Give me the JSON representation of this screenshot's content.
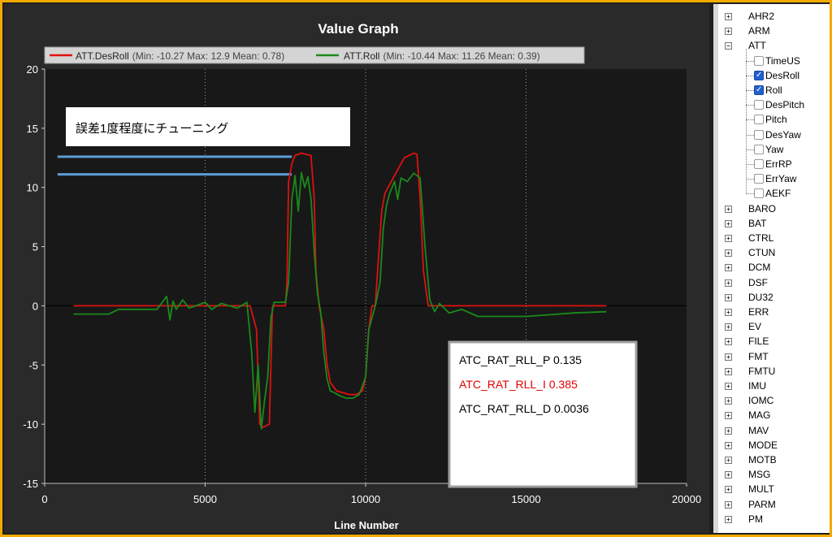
{
  "graph": {
    "title": "Value Graph",
    "x_axis_label": "Line Number",
    "legend": [
      {
        "name": "ATT.DesRoll",
        "stats": "(Min: -10.27 Max: 12.9 Mean: 0.78)",
        "color": "#e01010"
      },
      {
        "name": "ATT.Roll",
        "stats": "(Min: -10.44 Max: 11.26 Mean: 0.39)",
        "color": "#1a8a1a"
      }
    ],
    "y_ticks": [
      "20",
      "15",
      "10",
      "5",
      "0",
      "-5",
      "-10",
      "-15"
    ],
    "x_ticks": [
      "0",
      "5000",
      "10000",
      "15000",
      "20000"
    ],
    "annotation_note": "誤差1度程度にチューニング",
    "pid_box": {
      "p": "ATC_RAT_RLL_P  0.135",
      "i": "ATC_RAT_RLL_I   0.385",
      "d": "ATC_RAT_RLL_D  0.0036",
      "i_color": "#e00000"
    }
  },
  "chart_data": {
    "type": "line",
    "title": "Value Graph",
    "xlabel": "Line Number",
    "ylabel": "",
    "xlim": [
      0,
      20000
    ],
    "ylim": [
      -15,
      20
    ],
    "grid": "vertical dotted",
    "legend_position": "top",
    "series": [
      {
        "name": "ATT.DesRoll",
        "color": "#e01010",
        "x": [
          900,
          6400,
          6600,
          6700,
          6800,
          7000,
          7100,
          7500,
          7550,
          7600,
          7700,
          7800,
          8000,
          8300,
          8400,
          8450,
          8550,
          8700,
          8800,
          8900,
          9100,
          9500,
          9700,
          9900,
          10000,
          10100,
          10200,
          10300,
          10350,
          10500,
          10600,
          10800,
          11000,
          11200,
          11500,
          11600,
          11700,
          11800,
          11950,
          12050,
          12150,
          13000,
          17500
        ],
        "y": [
          0,
          0,
          -2,
          -10,
          -10.27,
          -10,
          0,
          0,
          2,
          10.5,
          12,
          12.7,
          12.9,
          12.7,
          9,
          3,
          0,
          -2,
          -5,
          -6.5,
          -7.2,
          -7.5,
          -7.5,
          -7.2,
          -6,
          -2,
          0,
          0,
          2,
          8,
          9.5,
          10.5,
          11.5,
          12.5,
          12.9,
          12.8,
          9,
          3,
          0,
          0,
          0,
          0,
          0
        ]
      },
      {
        "name": "ATT.Roll",
        "color": "#1a8a1a",
        "x": [
          900,
          2000,
          2300,
          3500,
          3800,
          3900,
          4000,
          4100,
          4300,
          4500,
          5000,
          5200,
          5500,
          6000,
          6300,
          6450,
          6550,
          6650,
          6750,
          6850,
          6950,
          7050,
          7150,
          7350,
          7500,
          7600,
          7700,
          7800,
          7900,
          8000,
          8100,
          8200,
          8300,
          8400,
          8500,
          8600,
          8700,
          8800,
          8900,
          9000,
          9200,
          9400,
          9600,
          9800,
          10000,
          10100,
          10200,
          10300,
          10450,
          10550,
          10650,
          10750,
          10900,
          11000,
          11100,
          11300,
          11500,
          11700,
          11850,
          12000,
          12150,
          12300,
          12600,
          13000,
          13500,
          15000,
          16500,
          17500
        ],
        "y": [
          -0.7,
          -0.7,
          -0.3,
          -0.3,
          0.8,
          -1.2,
          0.4,
          -0.3,
          0.5,
          -0.2,
          0.3,
          -0.3,
          0.2,
          -0.2,
          0.3,
          -4,
          -9,
          -5,
          -10.4,
          -8,
          -6,
          -1,
          0.3,
          0.3,
          0.3,
          2,
          9,
          11,
          8,
          11.26,
          10,
          10.9,
          9,
          4.5,
          1,
          -0.5,
          -4,
          -6.2,
          -7.2,
          -7.3,
          -7.6,
          -7.8,
          -7.8,
          -7.5,
          -6,
          -2,
          -1,
          0,
          2,
          6.5,
          8.5,
          9.5,
          10.5,
          9,
          10.8,
          10.5,
          11.2,
          10.8,
          5,
          0.5,
          -0.5,
          0.2,
          -0.6,
          -0.3,
          -0.9,
          -0.9,
          -0.6,
          -0.5
        ]
      }
    ],
    "reference_lines": [
      {
        "y": 12.6,
        "x_from": 400,
        "x_to": 7700,
        "color": "#5b9bd5"
      },
      {
        "y": 11.1,
        "x_from": 400,
        "x_to": 7700,
        "color": "#5b9bd5"
      }
    ]
  },
  "tree": {
    "items": [
      {
        "label": "AHR2",
        "type": "group",
        "expander": "+"
      },
      {
        "label": "ARM",
        "type": "group",
        "expander": "+"
      },
      {
        "label": "ATT",
        "type": "group",
        "expander": "−"
      },
      {
        "label": "TimeUS",
        "type": "leaf",
        "checked": false
      },
      {
        "label": "DesRoll",
        "type": "leaf",
        "checked": true
      },
      {
        "label": "Roll",
        "type": "leaf",
        "checked": true
      },
      {
        "label": "DesPitch",
        "type": "leaf",
        "checked": false
      },
      {
        "label": "Pitch",
        "type": "leaf",
        "checked": false
      },
      {
        "label": "DesYaw",
        "type": "leaf",
        "checked": false
      },
      {
        "label": "Yaw",
        "type": "leaf",
        "checked": false
      },
      {
        "label": "ErrRP",
        "type": "leaf",
        "checked": false
      },
      {
        "label": "ErrYaw",
        "type": "leaf",
        "checked": false
      },
      {
        "label": "AEKF",
        "type": "leaf",
        "checked": false
      },
      {
        "label": "BARO",
        "type": "group",
        "expander": "+"
      },
      {
        "label": "BAT",
        "type": "group",
        "expander": "+"
      },
      {
        "label": "CTRL",
        "type": "group",
        "expander": "+"
      },
      {
        "label": "CTUN",
        "type": "group",
        "expander": "+"
      },
      {
        "label": "DCM",
        "type": "group",
        "expander": "+"
      },
      {
        "label": "DSF",
        "type": "group",
        "expander": "+"
      },
      {
        "label": "DU32",
        "type": "group",
        "expander": "+"
      },
      {
        "label": "ERR",
        "type": "group",
        "expander": "+"
      },
      {
        "label": "EV",
        "type": "group",
        "expander": "+"
      },
      {
        "label": "FILE",
        "type": "group",
        "expander": "+"
      },
      {
        "label": "FMT",
        "type": "group",
        "expander": "+"
      },
      {
        "label": "FMTU",
        "type": "group",
        "expander": "+"
      },
      {
        "label": "IMU",
        "type": "group",
        "expander": "+"
      },
      {
        "label": "IOMC",
        "type": "group",
        "expander": "+"
      },
      {
        "label": "MAG",
        "type": "group",
        "expander": "+"
      },
      {
        "label": "MAV",
        "type": "group",
        "expander": "+"
      },
      {
        "label": "MODE",
        "type": "group",
        "expander": "+"
      },
      {
        "label": "MOTB",
        "type": "group",
        "expander": "+"
      },
      {
        "label": "MSG",
        "type": "group",
        "expander": "+"
      },
      {
        "label": "MULT",
        "type": "group",
        "expander": "+"
      },
      {
        "label": "PARM",
        "type": "group",
        "expander": "+"
      },
      {
        "label": "PM",
        "type": "group",
        "expander": "+"
      }
    ]
  }
}
